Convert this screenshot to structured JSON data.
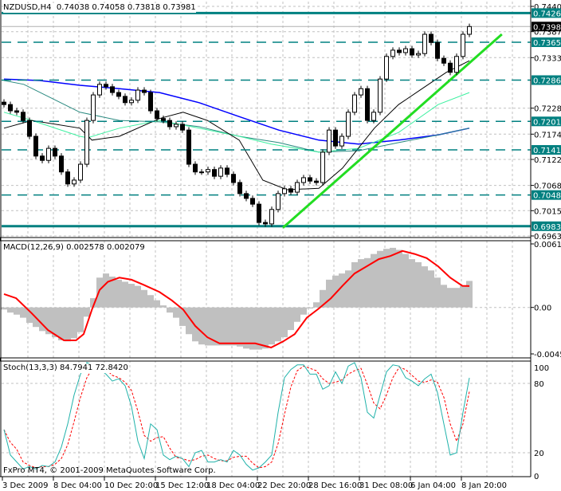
{
  "header": {
    "symbol": "NZDUSD,H4",
    "ohlc": "0.74038 0.74058 0.73818 0.73981"
  },
  "macd_label": "MACD(12,26,9) 0.002578 0.002079",
  "stoch_label": "Stoch(13,3,3) 84.7941 72.8420",
  "copyright": "FxPro MT4, © 2001-2009 MetaQuotes Software Corp.",
  "colors": {
    "level": "#008080",
    "ma_blue": "#0000ff",
    "ma_teal": "#2a8a80",
    "ma_light": "#3cf0a0",
    "ma_black": "#000000",
    "trendline": "#22dd22",
    "macd_hist": "#c0c0c0",
    "macd_signal": "#ff0000",
    "stoch_main": "#20b2aa",
    "stoch_signal": "#ff0000",
    "grid": "#c0c0c0"
  },
  "chart_data": [
    {
      "type": "candlestick",
      "title": "NZDUSD,H4",
      "ylim": [
        0.6963,
        0.744
      ],
      "y_ticks": [
        "0.74400",
        "0.73875",
        "0.73335",
        "0.72285",
        "0.71745",
        "0.71220",
        "0.70680",
        "0.70155",
        "0.69630"
      ],
      "x_labels": [
        "3 Dec 2009",
        "8 Dec 04:00",
        "10 Dec 20:00",
        "15 Dec 12:00",
        "18 Dec 04:00",
        "22 Dec 20:00",
        "28 Dec 16:00",
        "31 Dec 08:00",
        "6 Jan 04:00",
        "8 Jan 20:00"
      ],
      "current_price": "0.73981",
      "levels": [
        {
          "value": "0.74261",
          "style": "solid"
        },
        {
          "value": "0.73655",
          "style": "dashed"
        },
        {
          "value": "0.72868",
          "style": "dashed"
        },
        {
          "value": "0.72010",
          "style": "dashed"
        },
        {
          "value": "0.71418",
          "style": "dashed"
        },
        {
          "value": "0.70480",
          "style": "dashed"
        },
        {
          "value": "0.69832",
          "style": "solid"
        }
      ],
      "close": [
        0.7236,
        0.7223,
        0.722,
        0.7203,
        0.717,
        0.7129,
        0.712,
        0.7145,
        0.7129,
        0.7096,
        0.7071,
        0.7079,
        0.7112,
        0.7203,
        0.7256,
        0.7278,
        0.7273,
        0.7261,
        0.7253,
        0.724,
        0.7245,
        0.7266,
        0.7261,
        0.7223,
        0.7207,
        0.7203,
        0.719,
        0.7195,
        0.7183,
        0.7112,
        0.7096,
        0.7096,
        0.7101,
        0.7087,
        0.7104,
        0.7091,
        0.7074,
        0.7051,
        0.7041,
        0.7029,
        0.6991,
        0.6988,
        0.7018,
        0.7051,
        0.7061,
        0.7054,
        0.7074,
        0.7084,
        0.7077,
        0.7074,
        0.7137,
        0.7183,
        0.715,
        0.717,
        0.722,
        0.7256,
        0.7269,
        0.7203,
        0.722,
        0.7289,
        0.7336,
        0.7349,
        0.7344,
        0.7352,
        0.7339,
        0.7342,
        0.7382,
        0.7365,
        0.7332,
        0.7322,
        0.7303,
        0.7336,
        0.7382,
        0.73981
      ],
      "moving_averages": [
        {
          "name": "ma-blue",
          "color_key": "ma_blue",
          "points": [
            [
              0,
              0.7289
            ],
            [
              5.6,
              0.7286
            ],
            [
              11.9,
              0.7276
            ],
            [
              18.1,
              0.7269
            ],
            [
              24.4,
              0.7261
            ],
            [
              30.6,
              0.724
            ],
            [
              36.9,
              0.7211
            ],
            [
              43.1,
              0.7183
            ],
            [
              49.4,
              0.7162
            ],
            [
              55.6,
              0.7154
            ],
            [
              61.9,
              0.7162
            ],
            [
              68.1,
              0.7173
            ],
            [
              73,
              0.7187
            ]
          ]
        },
        {
          "name": "ma-teal",
          "color_key": "ma_teal",
          "points": [
            [
              0,
              0.7286
            ],
            [
              3.1,
              0.7278
            ],
            [
              11.9,
              0.722
            ],
            [
              18.1,
              0.7203
            ],
            [
              24.4,
              0.72
            ],
            [
              30.6,
              0.719
            ],
            [
              36.9,
              0.717
            ],
            [
              43.1,
              0.7157
            ],
            [
              49.4,
              0.7137
            ],
            [
              55.6,
              0.714
            ],
            [
              61.9,
              0.7157
            ],
            [
              68.1,
              0.7173
            ],
            [
              73,
              0.7187
            ]
          ]
        },
        {
          "name": "ma-light-green",
          "color_key": "ma_light",
          "points": [
            [
              0,
              0.722
            ],
            [
              4.4,
              0.7203
            ],
            [
              11.9,
              0.717
            ],
            [
              13.1,
              0.7167
            ],
            [
              18.1,
              0.7187
            ],
            [
              24.4,
              0.7203
            ],
            [
              30.6,
              0.7187
            ],
            [
              36.9,
              0.717
            ],
            [
              41.9,
              0.7154
            ],
            [
              49.4,
              0.7137
            ],
            [
              55.6,
              0.7145
            ],
            [
              61.9,
              0.7178
            ],
            [
              68.1,
              0.7236
            ],
            [
              73,
              0.7261
            ]
          ]
        },
        {
          "name": "ma-black",
          "color_key": "ma_black",
          "points": [
            [
              0,
              0.7187
            ],
            [
              4.4,
              0.7203
            ],
            [
              11.9,
              0.7187
            ],
            [
              13.8,
              0.7162
            ],
            [
              18.1,
              0.717
            ],
            [
              24.4,
              0.7207
            ],
            [
              28.1,
              0.722
            ],
            [
              31.9,
              0.7203
            ],
            [
              36.9,
              0.7162
            ],
            [
              40.6,
              0.7079
            ],
            [
              44.4,
              0.7059
            ],
            [
              49.4,
              0.7062
            ],
            [
              53.1,
              0.7104
            ],
            [
              58.1,
              0.7187
            ],
            [
              61.9,
              0.7236
            ],
            [
              65.6,
              0.7269
            ],
            [
              69.4,
              0.7303
            ],
            [
              73,
              0.7327
            ]
          ]
        }
      ],
      "trendline": [
        [
          43.75,
          0.698
        ],
        [
          78.1,
          0.7382
        ]
      ]
    },
    {
      "type": "bar",
      "title": "MACD(12,26,9)",
      "ylim": [
        -0.00452,
        0.00618
      ],
      "y_ticks": [
        "0.00618",
        "0.00",
        "-0.00452"
      ],
      "histogram": [
        -0.0002,
        -0.0005,
        -0.0007,
        -0.001,
        -0.0015,
        -0.0019,
        -0.0023,
        -0.0026,
        -0.0029,
        -0.0032,
        -0.0033,
        -0.003,
        -0.0024,
        -0.0009,
        0.0009,
        0.0029,
        0.0033,
        0.003,
        0.0027,
        0.0025,
        0.0023,
        0.0021,
        0.0017,
        0.0012,
        0.0007,
        0.0002,
        -0.0005,
        -0.001,
        -0.0018,
        -0.0026,
        -0.0033,
        -0.0036,
        -0.0037,
        -0.0037,
        -0.0037,
        -0.0037,
        -0.0037,
        -0.0038,
        -0.004,
        -0.0041,
        -0.0041,
        -0.004,
        -0.0036,
        -0.0033,
        -0.0029,
        -0.0022,
        -0.0014,
        -0.0007,
        -0.0001,
        0.0005,
        0.0017,
        0.0027,
        0.0031,
        0.0033,
        0.0036,
        0.0044,
        0.0047,
        0.0048,
        0.0052,
        0.0055,
        0.0057,
        0.0058,
        0.0056,
        0.0052,
        0.0047,
        0.0044,
        0.004,
        0.0036,
        0.0029,
        0.0022,
        0.0019,
        0.0019,
        0.0021,
        0.002578
      ],
      "signal": [
        [
          0,
          0.0013
        ],
        [
          1.9,
          0.0009
        ],
        [
          4.4,
          -0.0006
        ],
        [
          6.9,
          -0.0022
        ],
        [
          9.4,
          -0.0032
        ],
        [
          11.3,
          -0.0032
        ],
        [
          12.5,
          -0.0026
        ],
        [
          13.8,
          -0.0002
        ],
        [
          15,
          0.0017
        ],
        [
          16.3,
          0.0025
        ],
        [
          18.1,
          0.0029
        ],
        [
          20,
          0.0027
        ],
        [
          21.9,
          0.0022
        ],
        [
          24.4,
          0.0015
        ],
        [
          26.3,
          0.0007
        ],
        [
          28.1,
          -0.0002
        ],
        [
          30,
          -0.0018
        ],
        [
          31.9,
          -0.0029
        ],
        [
          33.8,
          -0.0035
        ],
        [
          36.9,
          -0.0035
        ],
        [
          39.4,
          -0.0035
        ],
        [
          41.9,
          -0.0039
        ],
        [
          43.8,
          -0.0033
        ],
        [
          45.6,
          -0.0026
        ],
        [
          47.5,
          -0.001
        ],
        [
          49.4,
          -0.0001
        ],
        [
          51.3,
          0.0009
        ],
        [
          53.1,
          0.0021
        ],
        [
          55,
          0.0033
        ],
        [
          56.9,
          0.004
        ],
        [
          58.8,
          0.0047
        ],
        [
          60.6,
          0.005
        ],
        [
          62.5,
          0.0055
        ],
        [
          64.4,
          0.0052
        ],
        [
          66.3,
          0.0048
        ],
        [
          68.1,
          0.004
        ],
        [
          70,
          0.0029
        ],
        [
          71.9,
          0.0021
        ],
        [
          73,
          0.002079
        ]
      ]
    },
    {
      "type": "line",
      "title": "Stoch(13,3,3)",
      "ylim": [
        0,
        100
      ],
      "y_ticks": [
        "100",
        "80",
        "20",
        "0"
      ],
      "main": [
        40,
        18,
        12,
        6,
        8,
        6,
        9,
        8,
        12,
        25,
        45,
        70,
        88,
        98,
        96,
        92,
        88,
        82,
        84,
        78,
        60,
        30,
        15,
        45,
        40,
        18,
        14,
        17,
        15,
        8,
        20,
        22,
        12,
        12,
        14,
        12,
        22,
        18,
        10,
        5,
        7,
        12,
        18,
        55,
        85,
        92,
        96,
        96,
        88,
        88,
        75,
        78,
        90,
        80,
        95,
        98,
        85,
        55,
        50,
        70,
        90,
        96,
        95,
        85,
        82,
        78,
        84,
        88,
        72,
        45,
        18,
        20,
        55,
        84.7941
      ],
      "signal": [
        40,
        29,
        23,
        12,
        9,
        7,
        8,
        8,
        10,
        15,
        27,
        47,
        68,
        85,
        94,
        95,
        92,
        87,
        85,
        81,
        74,
        56,
        35,
        30,
        33,
        34,
        24,
        16,
        15,
        13,
        14,
        17,
        18,
        15,
        13,
        13,
        16,
        17,
        17,
        11,
        7,
        8,
        12,
        28,
        53,
        77,
        91,
        95,
        93,
        91,
        84,
        80,
        81,
        83,
        88,
        91,
        93,
        79,
        63,
        58,
        70,
        85,
        94,
        92,
        87,
        82,
        81,
        83,
        81,
        68,
        45,
        30,
        45,
        72.842
      ]
    }
  ]
}
